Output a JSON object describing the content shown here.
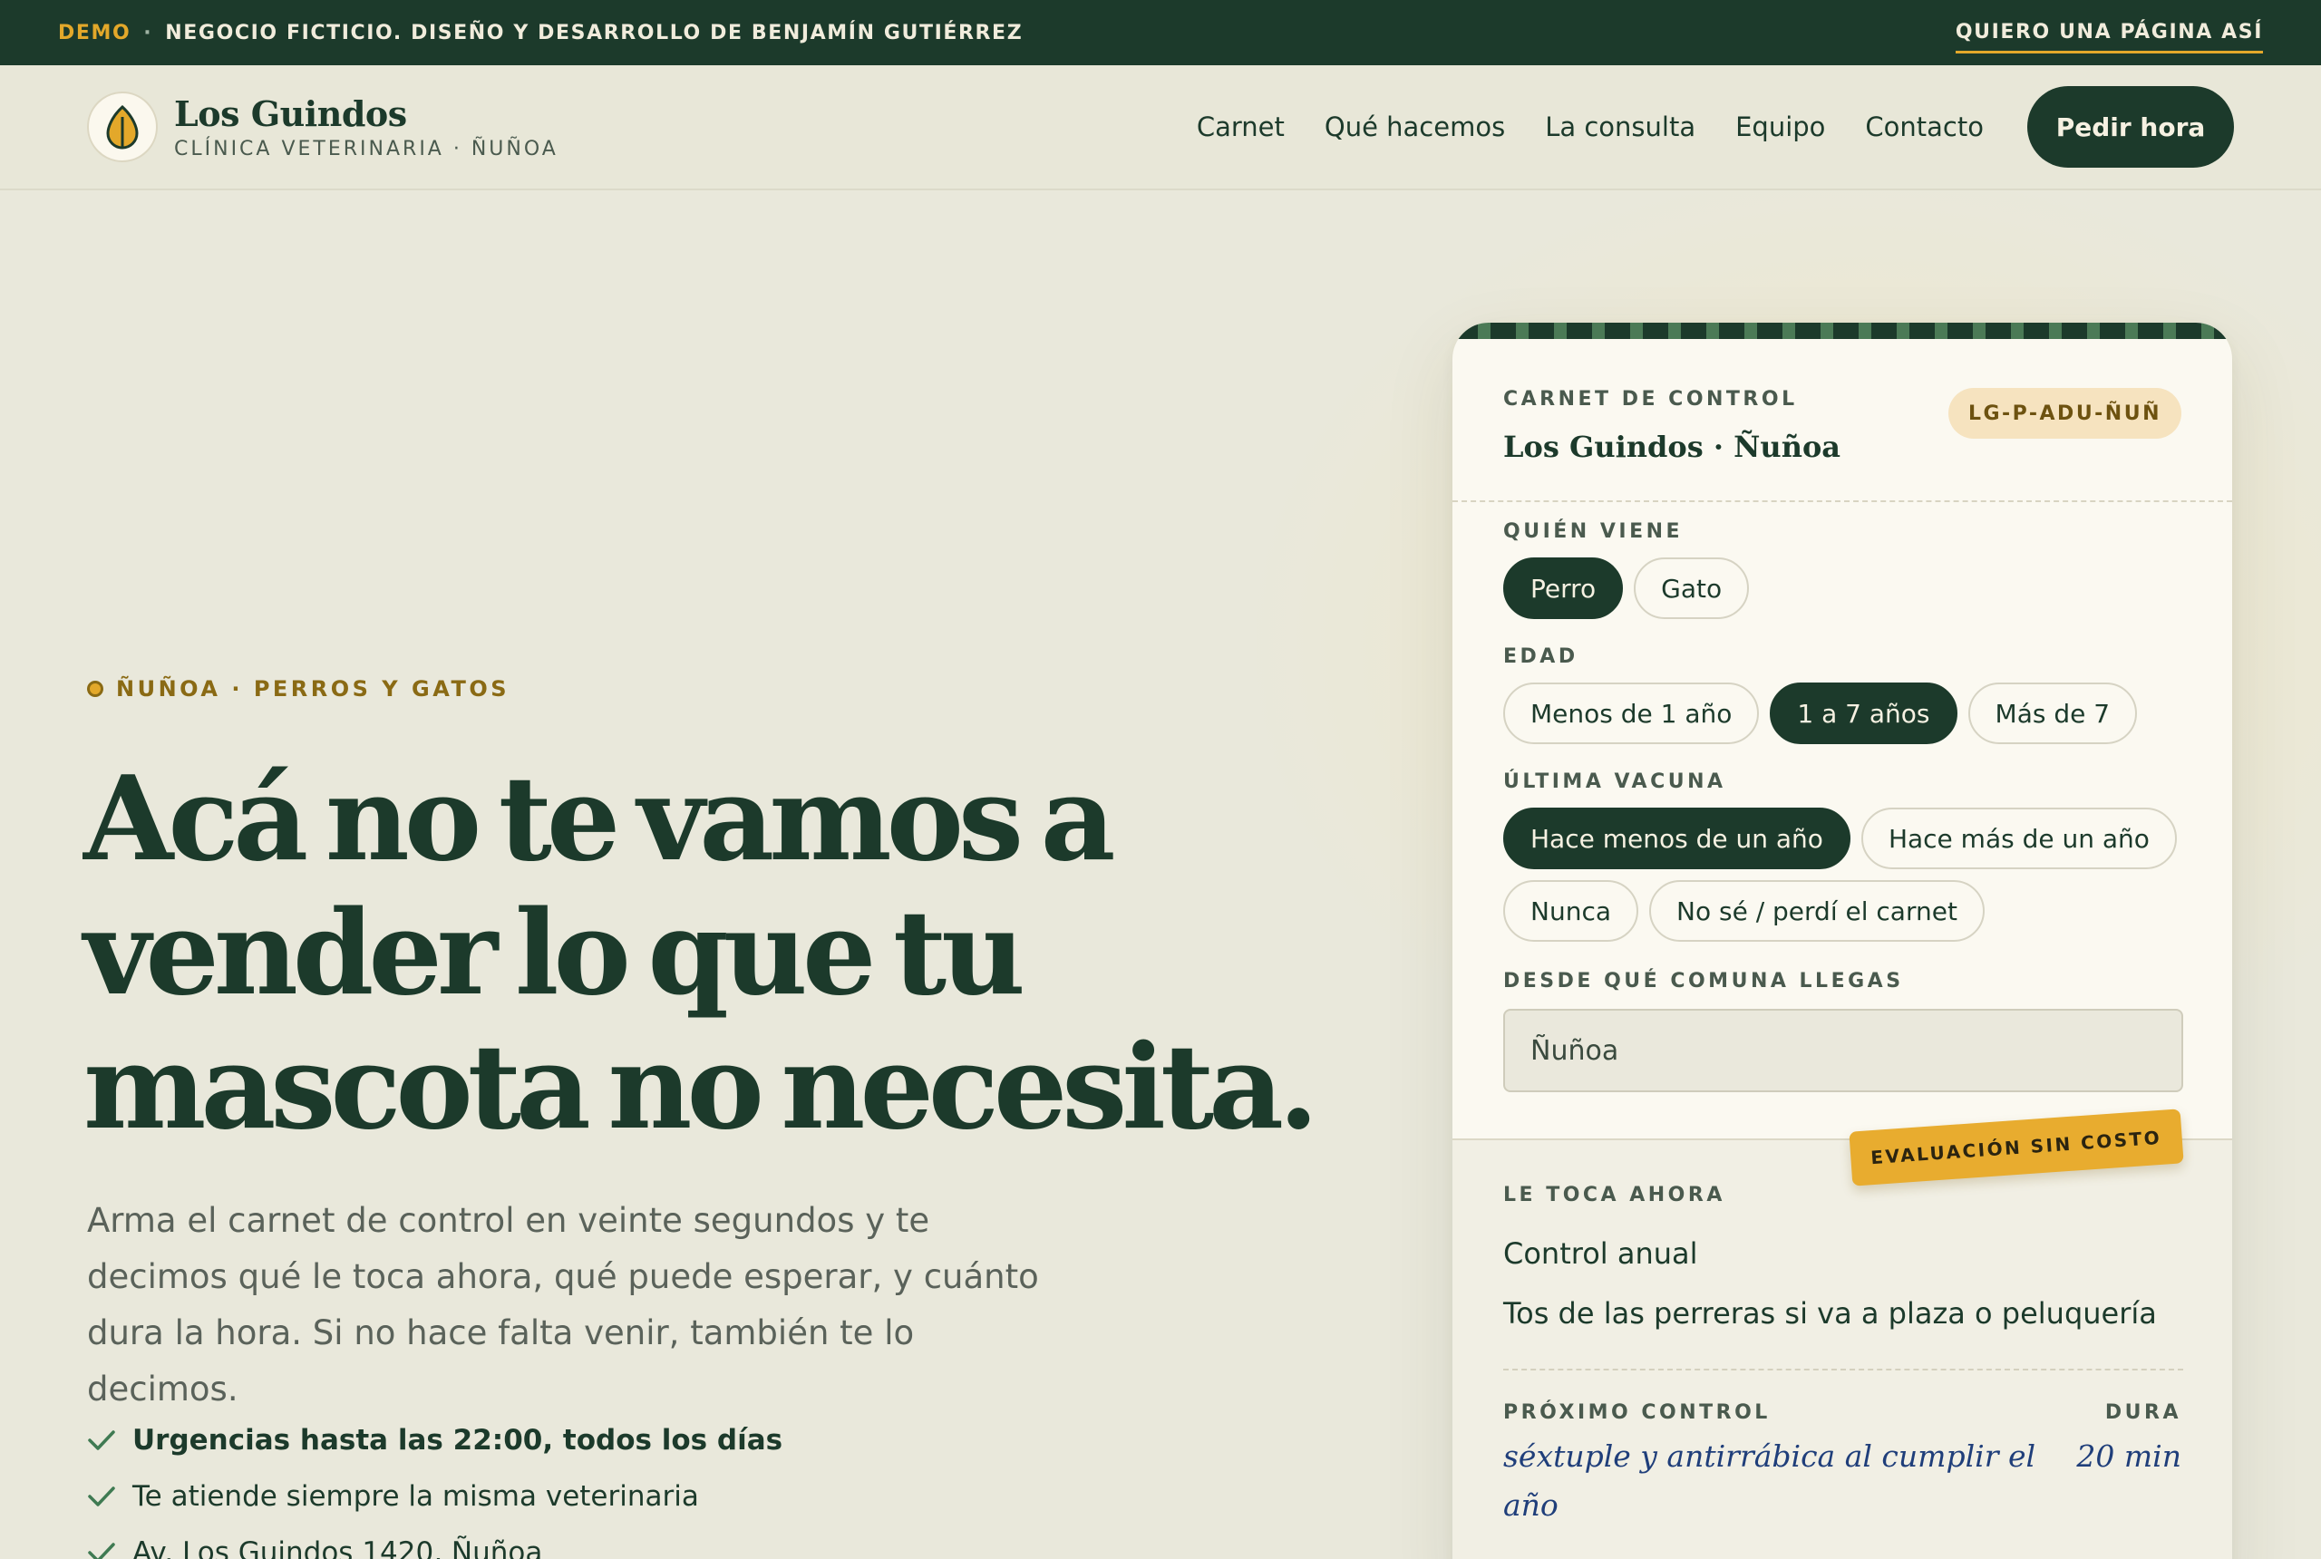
{
  "demo_bar": {
    "tag": "DEMO",
    "separator": "·",
    "text": "NEGOCIO FICTICIO. DISEÑO Y DESARROLLO DE  BENJAMÍN GUTIÉRREZ",
    "cta": "QUIERO UNA PÁGINA ASÍ"
  },
  "brand": {
    "logo_icon": "leaf-icon",
    "name": "Los Guindos",
    "subtitle": "CLÍNICA VETERINARIA · ÑUÑOA"
  },
  "nav": {
    "items": [
      "Carnet",
      "Qué hacemos",
      "La consulta",
      "Equipo",
      "Contacto"
    ],
    "cta": "Pedir hora"
  },
  "hero": {
    "eyebrow": "ÑUÑOA · PERROS Y GATOS",
    "headline": "Acá no te vamos a vender lo que tu mascota no necesita.",
    "lead": "Arma el carnet de control en veinte segundos y te decimos qué le toca ahora, qué puede esperar, y cuánto dura la hora. Si no hace falta venir, también te lo decimos.",
    "checks": [
      "Urgencias hasta las 22:00, todos los días",
      "Te atiende siempre la misma veterinaria",
      "Av. Los Guindos 1420, Ñuñoa"
    ]
  },
  "card": {
    "label": "CARNET DE CONTROL",
    "clinic": "Los Guindos · Ñuñoa",
    "code": "LG-P-ADU-ÑUÑ",
    "who": {
      "label": "QUIÉN VIENE",
      "options": [
        "Perro",
        "Gato"
      ],
      "selected": "Perro"
    },
    "age": {
      "label": "EDAD",
      "options": [
        "Menos de 1 año",
        "1 a 7 años",
        "Más de 7"
      ],
      "selected": "1 a 7 años"
    },
    "vaccine": {
      "label": "ÚLTIMA VACUNA",
      "options": [
        "Hace menos de un año",
        "Hace más de un año",
        "Nunca",
        "No sé / perdí el carnet"
      ],
      "selected": "Hace menos de un año"
    },
    "comuna": {
      "label": "DESDE QUÉ COMUNA LLEGAS",
      "value": "Ñuñoa"
    },
    "result": {
      "stamp": "EVALUACIÓN SIN COSTO",
      "now_label": "LE TOCA AHORA",
      "now_items": [
        "Control anual",
        "Tos de las perreras si va a plaza o peluquería"
      ],
      "next_label": "PRÓXIMO CONTROL",
      "next_value": "séxtuple y antirrábica al cumplir el año",
      "duration_label": "DURA",
      "duration_value": "20 min"
    }
  },
  "colors": {
    "primary": "#1c3a2b",
    "accent": "#e3a82a",
    "background": "#e9e8db",
    "card": "#fbf9f1",
    "handwriting": "#1f3e7a"
  }
}
